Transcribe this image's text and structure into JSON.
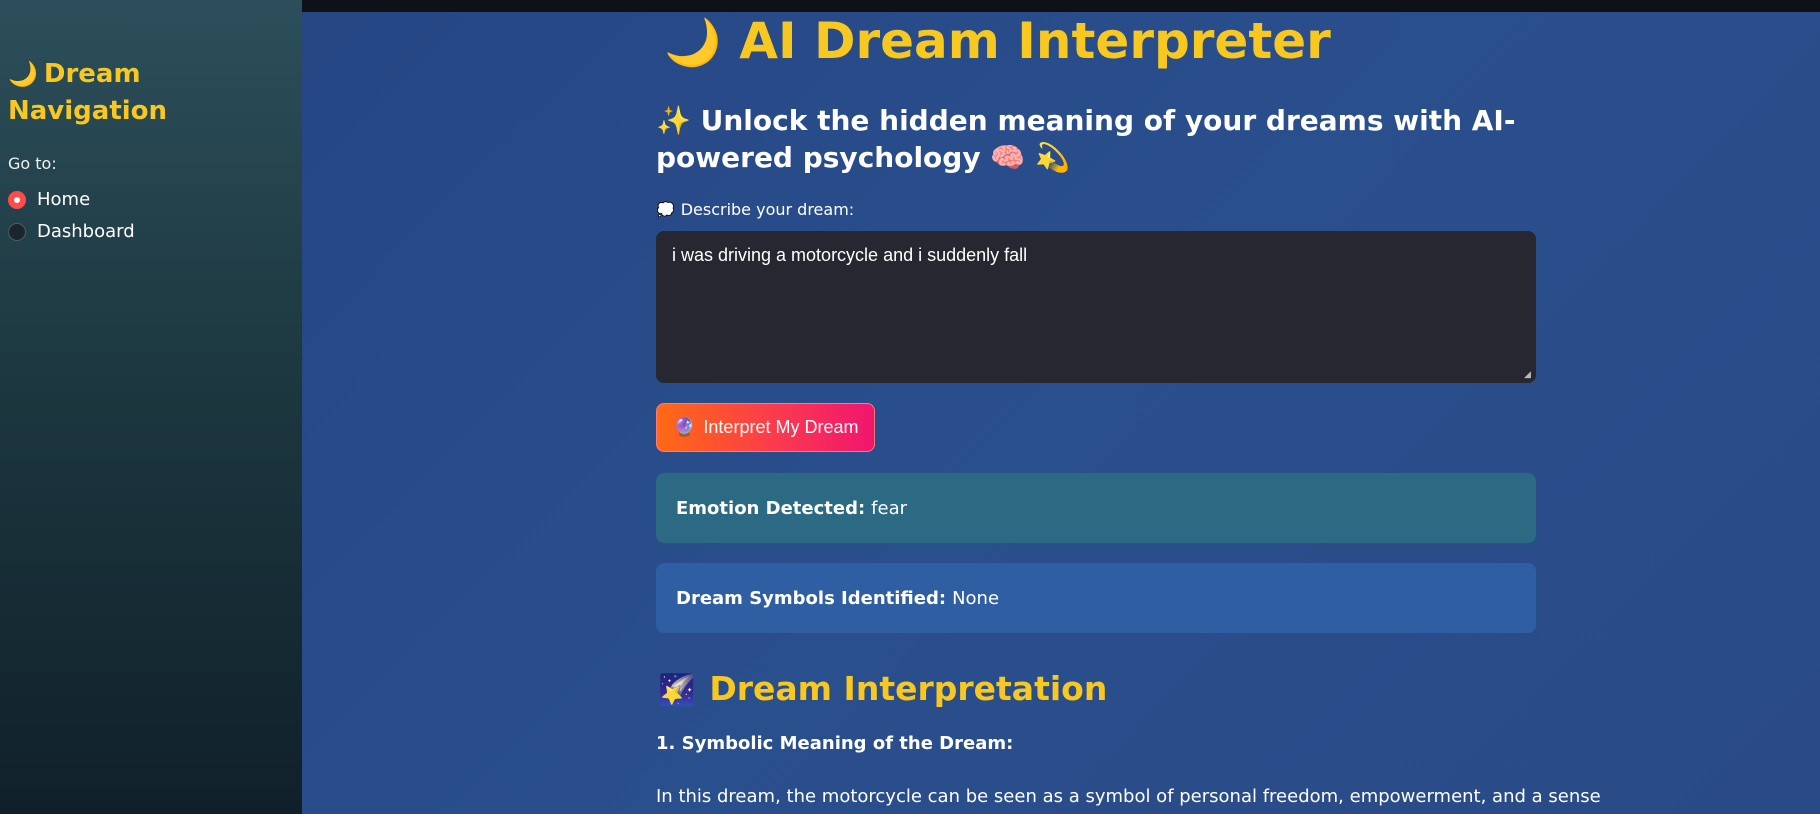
{
  "sidebar": {
    "title_emoji": "🌙",
    "title": "Dream Navigation",
    "goto_label": "Go to:",
    "options": [
      {
        "label": "Home",
        "selected": true
      },
      {
        "label": "Dashboard",
        "selected": false
      }
    ]
  },
  "main": {
    "title_emoji": "🌙",
    "title": "AI Dream Interpreter",
    "subtitle_emoji": "✨",
    "subtitle": "Unlock the hidden meaning of your dreams with AI-powered psychology 🧠 💫",
    "input_label_emoji": "💭",
    "input_label": "Describe your dream:",
    "input_value": "i was driving a motorcycle and i suddenly fall",
    "button_emoji": "🔮",
    "button_label": "Interpret My Dream",
    "emotion": {
      "key": "Emotion Detected:",
      "value": "fear"
    },
    "symbols": {
      "key": "Dream Symbols Identified:",
      "value": "None"
    },
    "section_emoji": "🌠",
    "section_title": "Dream Interpretation",
    "paragraph_heading": "1. Symbolic Meaning of the Dream:",
    "paragraph_text": "In this dream, the motorcycle can be seen as a symbol of personal freedom, empowerment, and a sense"
  },
  "colors": {
    "accent_yellow": "#f7c81f",
    "sidebar_bg": "#1d3840",
    "main_bg": "#284a88",
    "input_bg": "#262730",
    "emotion_box": "#2b6a82",
    "symbols_box": "#2f5ea3",
    "radio_selected": "#ff4b4b",
    "button_gradient_start": "#ff6a13",
    "button_gradient_end": "#f0156f"
  }
}
